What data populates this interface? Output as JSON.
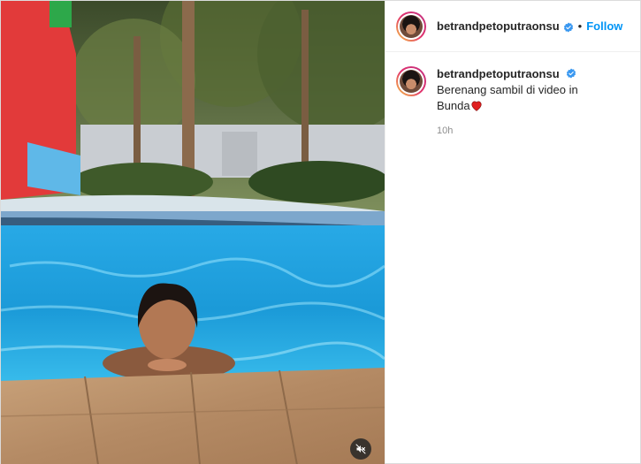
{
  "post": {
    "author": {
      "username": "betrandpetoputraonsu",
      "verified": true
    },
    "header": {
      "separator": "•",
      "follow_label": "Follow"
    },
    "caption": {
      "text": "Berenang sambil di video in Bunda",
      "emoji": "red-heart-icon"
    },
    "timestamp": "10h",
    "media": {
      "type": "video",
      "muted": true,
      "mute_icon": "speaker-muted-icon"
    }
  },
  "colors": {
    "accent": "#0095f6",
    "verified": "#3897f0",
    "muted_text": "#8e8e8e",
    "pool_water": "#1fa6e0"
  }
}
